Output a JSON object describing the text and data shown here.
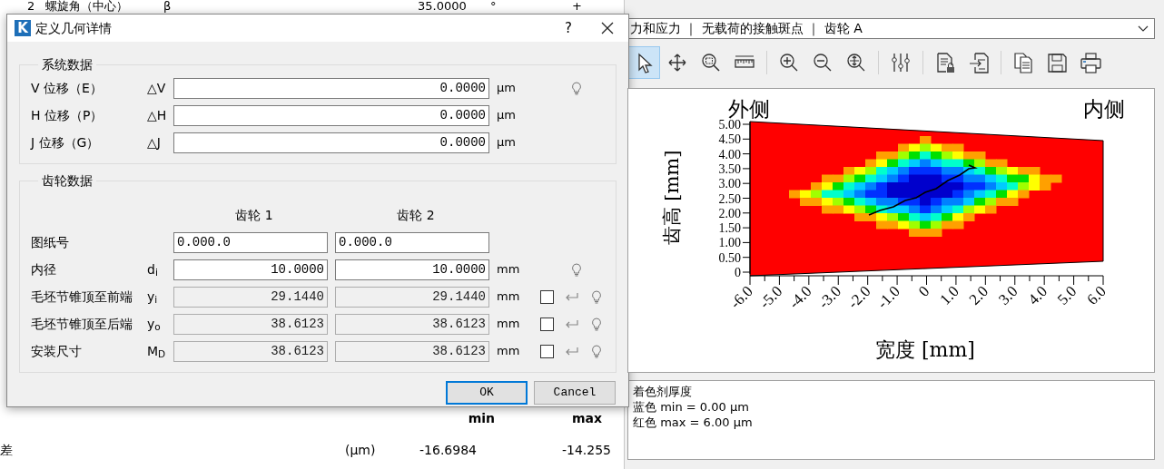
{
  "background_window": {
    "top_row": {
      "index": "2",
      "name": "螺旋角（中心）",
      "symbol": "β",
      "value": "35.0000",
      "unit": "°",
      "sign": "+"
    },
    "table": {
      "columns": [
        "min",
        "max"
      ],
      "rows": [
        {
          "label": "差",
          "unit": "(µm)",
          "min": "-16.6984",
          "max": "-14.255"
        }
      ]
    }
  },
  "dialog": {
    "app_icon_letter": "K",
    "title": "定义几何详情",
    "help": "?",
    "system_data": {
      "title": "系统数据",
      "rows": [
        {
          "label": "V 位移（E）",
          "symbol": "△V",
          "value": "0.0000",
          "unit": "µm",
          "hint": true
        },
        {
          "label": "H 位移（P）",
          "symbol": "△H",
          "value": "0.0000",
          "unit": "µm",
          "hint": false
        },
        {
          "label": "J 位移（G）",
          "symbol": "△J",
          "value": "0.0000",
          "unit": "µm",
          "hint": false
        }
      ]
    },
    "gear_data": {
      "title": "齿轮数据",
      "columns": [
        "齿轮 1",
        "齿轮 2"
      ],
      "rows": [
        {
          "kind": "text",
          "label": "图纸号",
          "values": [
            "0.000.0",
            "0.000.0"
          ],
          "disabled": false
        },
        {
          "kind": "number",
          "label": "内径",
          "symbol": "d$_{i}$",
          "values": [
            "10.0000",
            "10.0000"
          ],
          "unit": "mm",
          "disabled": false,
          "hint": true
        },
        {
          "kind": "override",
          "label": "毛坯节锥顶至前端",
          "symbol": "y$_{i}$",
          "values": [
            "29.1440",
            "29.1440"
          ],
          "unit": "mm",
          "disabled": true,
          "checked": false,
          "hint": true
        },
        {
          "kind": "override",
          "label": "毛坯节锥顶至后端",
          "symbol": "y$_{o}$",
          "values": [
            "38.6123",
            "38.6123"
          ],
          "unit": "mm",
          "disabled": true,
          "checked": false,
          "hint": true
        },
        {
          "kind": "override",
          "label": "安装尺寸",
          "symbol": "M$_{D}$",
          "values": [
            "38.6123",
            "38.6123"
          ],
          "unit": "mm",
          "disabled": true,
          "checked": false,
          "hint": true
        }
      ]
    },
    "buttons": [
      {
        "label": "OK",
        "default": true
      },
      {
        "label": "Cancel",
        "default": false
      }
    ]
  },
  "right_panel": {
    "view_selector": "力和应力 ｜ 无载荷的接触斑点 ｜ 齿轮 A",
    "toolbar": [
      {
        "kind": "pointer",
        "selected": true
      },
      {
        "kind": "move",
        "selected": false
      },
      {
        "kind": "zoom-window",
        "selected": false
      },
      {
        "kind": "ruler",
        "selected": false
      },
      {
        "kind": "separator"
      },
      {
        "kind": "zoom-in",
        "selected": false
      },
      {
        "kind": "zoom-out",
        "selected": false
      },
      {
        "kind": "zoom-fit",
        "selected": false
      },
      {
        "kind": "separator"
      },
      {
        "kind": "sliders",
        "selected": false
      },
      {
        "kind": "separator"
      },
      {
        "kind": "doc-lock",
        "selected": false
      },
      {
        "kind": "doc-import",
        "selected": false
      },
      {
        "kind": "separator"
      },
      {
        "kind": "copy",
        "selected": false
      },
      {
        "kind": "save",
        "selected": false
      },
      {
        "kind": "print",
        "selected": false
      }
    ],
    "chart": {
      "outer_label": "外侧",
      "inner_label": "内侧",
      "xlabel": "宽度 [mm]",
      "ylabel": "齿高 [mm]",
      "xtick_labels": [
        "-6.0",
        "-5.0",
        "-4.0",
        "-3.0",
        "-2.0",
        "-1.0",
        "0",
        "1.0",
        "2.0",
        "3.0",
        "4.0",
        "5.0",
        "6.0"
      ],
      "ytick_labels": [
        "5.00",
        "4.50",
        "4.00",
        "3.50",
        "3.00",
        "2.50",
        "2.00",
        "1.50",
        "1.00",
        "0.50",
        "0"
      ]
    },
    "legend": [
      "着色剂厚度",
      "蓝色 min = 0.00 µm",
      "红色 max = 6.00 µm"
    ]
  }
}
